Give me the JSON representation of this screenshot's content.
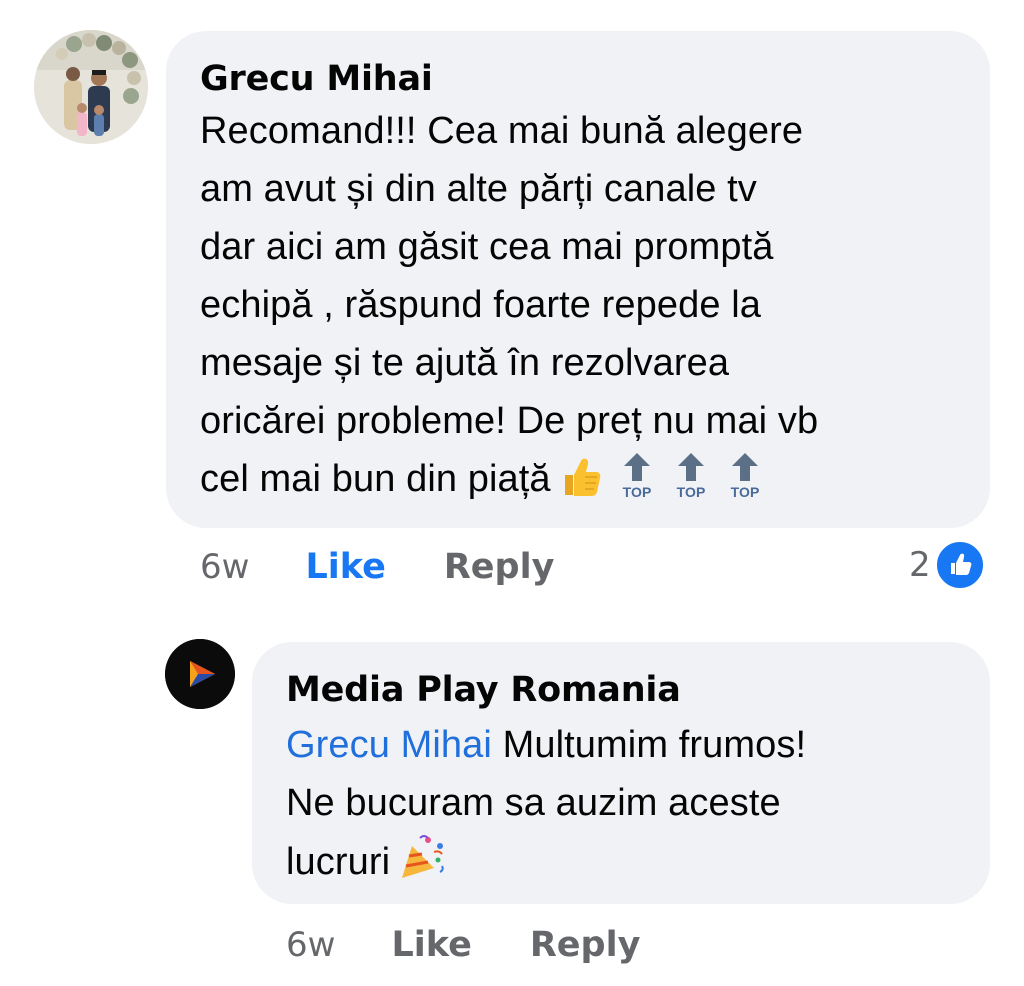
{
  "comment": {
    "author": "Grecu Mihai",
    "text": "Recomand!!! Cea mai bună alegere\nam avut și din alte părți canale tv\ndar aici am găsit cea mai promptă\nechipă , răspund foarte repede la\nmesaje și te ajută în rezolvarea\noricărei probleme! De preț nu mai vb\ncel mai bun din piață",
    "emojis": [
      "thumbs-up-icon",
      "top-arrow-icon",
      "top-arrow-icon",
      "top-arrow-icon"
    ],
    "top_label": "TOP",
    "time": "6w",
    "like_label": "Like",
    "reply_label": "Reply",
    "reaction_count": "2",
    "colors": {
      "like_active": "#1877f2",
      "bubble": "#f0f2f5",
      "meta": "#65676b"
    }
  },
  "reply": {
    "author": "Media Play Romania",
    "mention": "Grecu Mihai",
    "text_after_mention": " Multumim frumos!\nNe bucuram sa auzim aceste\nlucruri",
    "emoji": "party-popper-icon",
    "time": "6w",
    "like_label": "Like",
    "reply_label": "Reply",
    "colors": {
      "mention": "#216fdb"
    }
  }
}
